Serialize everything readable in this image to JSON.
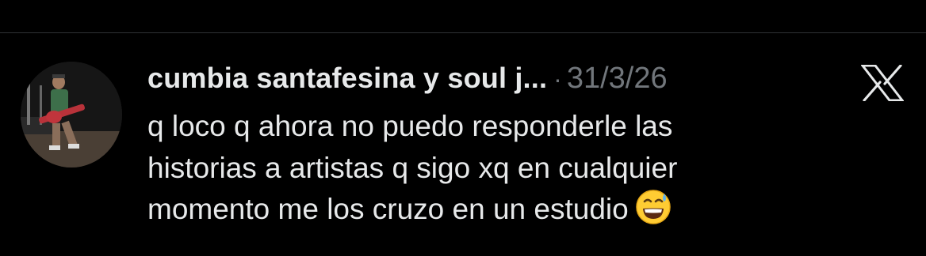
{
  "post": {
    "author_name": "cumbia santafesina y soul j...",
    "separator": "·",
    "date": "31/3/26",
    "text_lines": [
      "q loco q ahora no puedo responderle las",
      "historias a artistas q sigo xq en cualquier",
      "momento me los cruzo en un estudio"
    ],
    "emoji": "grinning-face-with-sweat"
  },
  "avatar": {
    "description_icon": "avatar-photo-guitarist"
  },
  "actions": {
    "close_icon": "x-logo-icon"
  },
  "colors": {
    "background": "#000000",
    "primary_text": "#e7e9ea",
    "secondary_text": "#71767b",
    "divider": "#2f3336"
  }
}
